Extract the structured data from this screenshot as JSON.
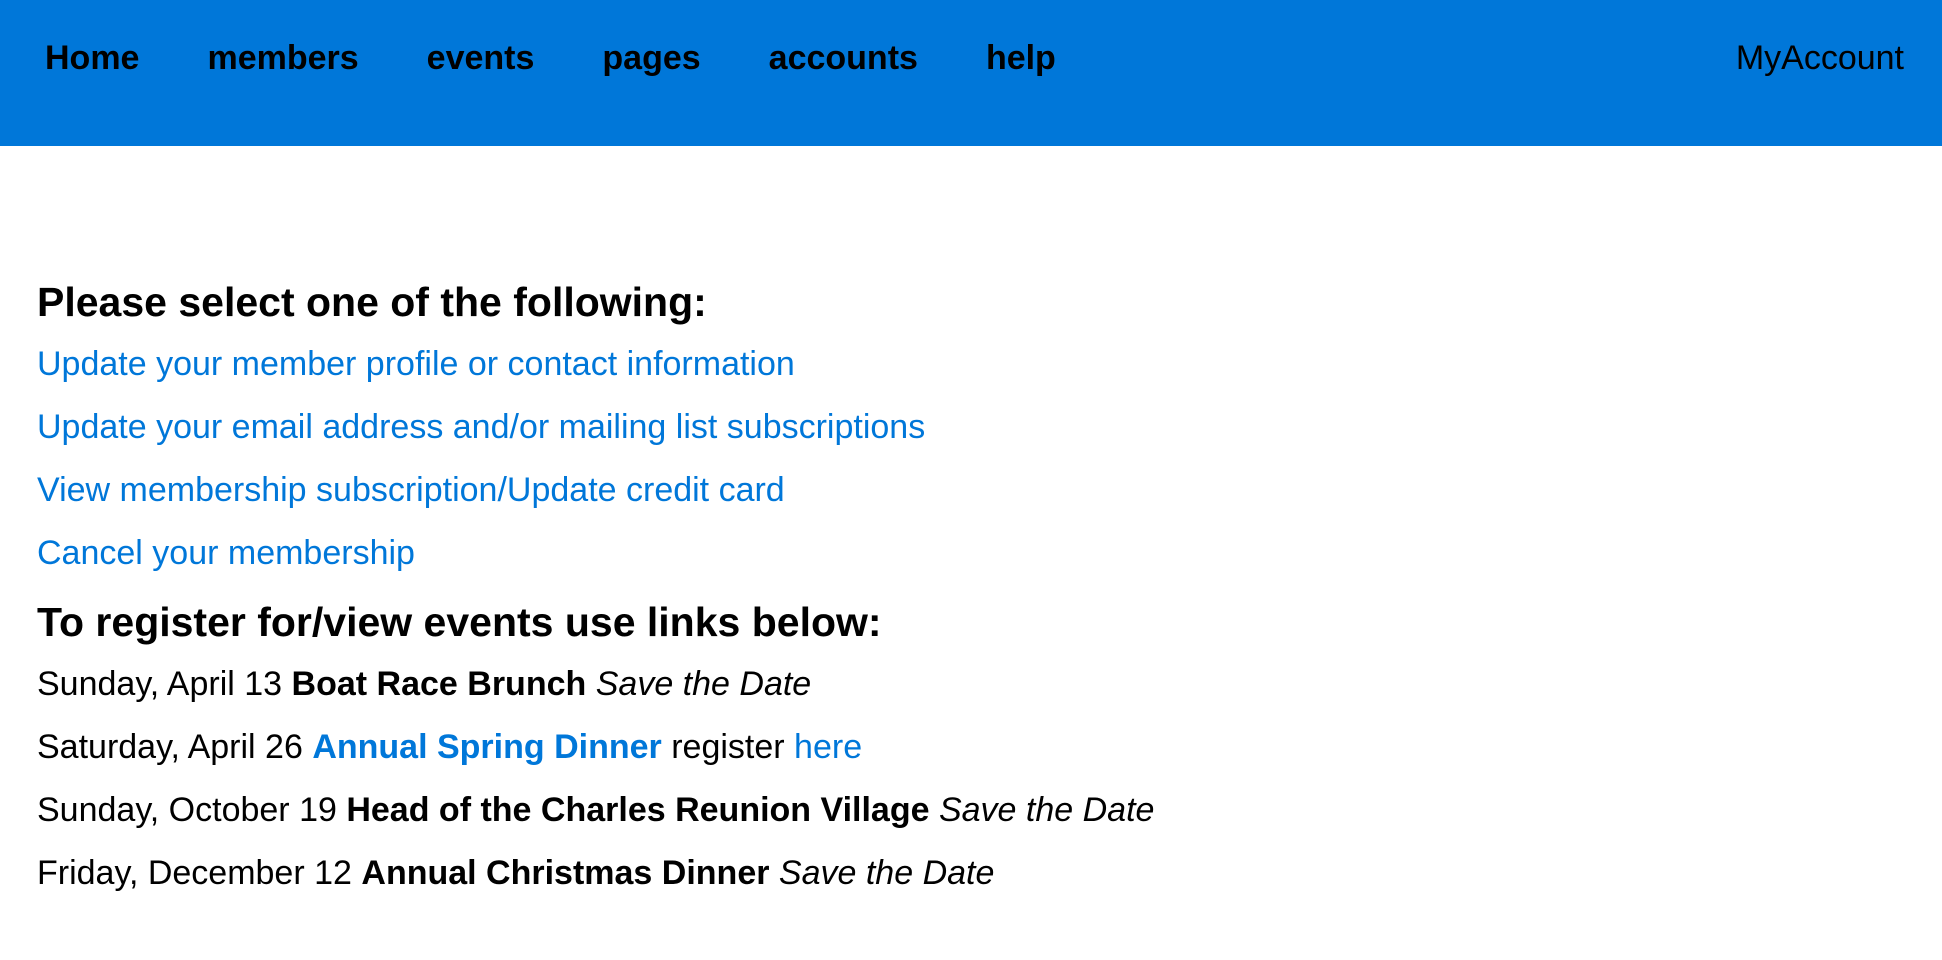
{
  "nav": {
    "items": [
      {
        "label": "Home"
      },
      {
        "label": "members"
      },
      {
        "label": "events"
      },
      {
        "label": "pages"
      },
      {
        "label": "accounts"
      },
      {
        "label": "help"
      }
    ],
    "account_label": "MyAccount"
  },
  "main": {
    "select_heading": "Please select one of the following:",
    "links": [
      {
        "label": "Update your member profile or contact information"
      },
      {
        "label": "Update your email address and/or mailing list subscriptions"
      },
      {
        "label": "View membership subscription/Update credit card"
      },
      {
        "label": "Cancel your membership"
      }
    ],
    "events_heading": "To register for/view events use links below:",
    "events": [
      {
        "date": "Sunday, April 13",
        "name": "Boat Race Brunch",
        "note": "Save the Date"
      },
      {
        "date": "Saturday, April 26",
        "name": "Annual Spring Dinner",
        "register_text": "register",
        "register_link": "here"
      },
      {
        "date": "Sunday, October 19",
        "name": "Head of the Charles Reunion Village",
        "note": "Save the Date"
      },
      {
        "date": "Friday, December 12",
        "name": "Annual Christmas Dinner",
        "note": "Save the Date"
      }
    ]
  },
  "colors": {
    "header_bg": "#0077d9",
    "link": "#0077d9",
    "text": "#000000",
    "background": "#ffffff"
  }
}
